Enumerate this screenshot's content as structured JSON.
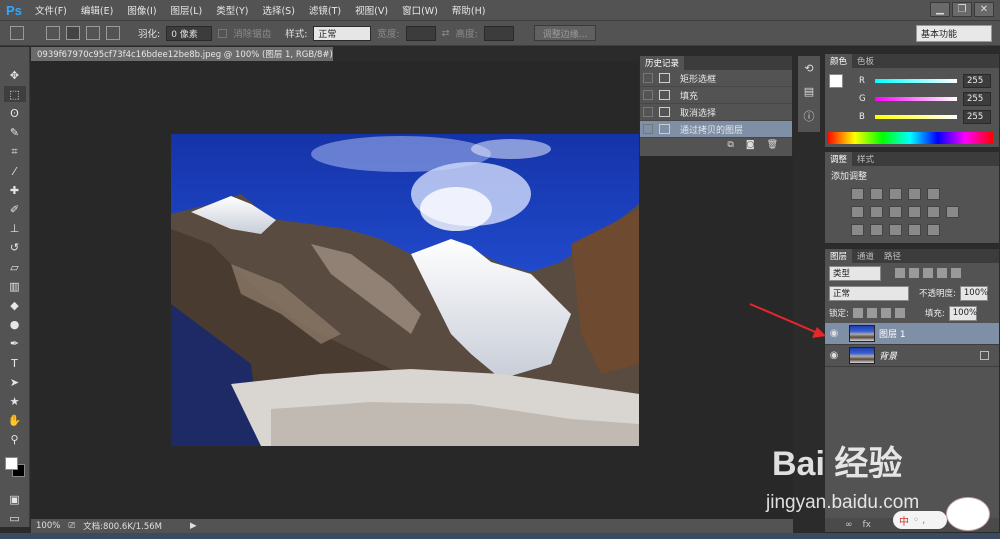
{
  "app": {
    "logo": "Ps",
    "menu": [
      "文件(F)",
      "编辑(E)",
      "图像(I)",
      "图层(L)",
      "类型(Y)",
      "选择(S)",
      "滤镜(T)",
      "视图(V)",
      "窗口(W)",
      "帮助(H)"
    ],
    "window_buttons": [
      "▁",
      "❐",
      "✕"
    ]
  },
  "options_bar": {
    "feather_label": "羽化:",
    "feather_value": "0 像素",
    "antialias_label": "消除锯齿",
    "style_label": "样式:",
    "style_value": "正常",
    "width_label": "宽度:",
    "height_label": "高度:",
    "refine_edge_button": "调整边缘...",
    "workspace": "基本功能"
  },
  "document": {
    "tab_title": "0939f67970c95cf73f4c16bdee12be8b.jpeg @ 100% (图层 1, RGB/8#) *",
    "tab_close": "×",
    "zoom": "100%",
    "doc_size": "文档:800.6K/1.56M"
  },
  "history": {
    "tabs": [
      "历史记录"
    ],
    "items": [
      {
        "label": "矩形选框",
        "selected": false
      },
      {
        "label": "填充",
        "selected": false
      },
      {
        "label": "取消选择",
        "selected": false
      },
      {
        "label": "通过拷贝的图层",
        "selected": true
      }
    ]
  },
  "color_panel": {
    "tabs": [
      "颜色",
      "色板"
    ],
    "r_label": "R",
    "r_value": "255",
    "g_label": "G",
    "g_value": "255",
    "b_label": "B",
    "b_value": "255"
  },
  "adjustments_panel": {
    "tabs": [
      "调整",
      "样式"
    ],
    "title": "添加调整"
  },
  "layers_panel": {
    "tabs": [
      "图层",
      "通道",
      "路径"
    ],
    "filter_value": "类型",
    "blend_mode": "正常",
    "opacity_label": "不透明度:",
    "opacity_value": "100%",
    "lock_label": "锁定:",
    "fill_label": "填充:",
    "fill_value": "100%",
    "layers": [
      {
        "name": "图层 1",
        "selected": true
      },
      {
        "name": "背景",
        "selected": false
      }
    ]
  },
  "watermark": {
    "brand": "Bai 经验",
    "url": "jingyan.baidu.com"
  },
  "ime": {
    "label": "中"
  },
  "colors": {
    "ui_panel": "#535353",
    "canvas_bg": "#282828",
    "selection": "#7f8fa6",
    "annotation_arrow": "#e8262a"
  }
}
